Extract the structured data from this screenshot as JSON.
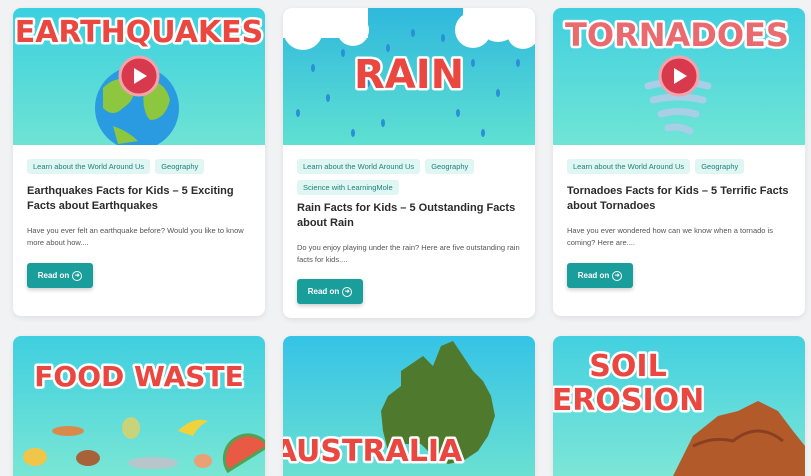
{
  "cards": [
    {
      "thumb_word": "EARTHQUAKES",
      "tags": [
        "Learn about the World Around Us",
        "Geography"
      ],
      "title": "Earthquakes Facts for Kids – 5 Exciting Facts about Earthquakes",
      "desc": "Have you ever felt an earthquake before? Would you like to know more about how....",
      "button": "Read on"
    },
    {
      "thumb_word": "RAIN",
      "tags": [
        "Learn about the World Around Us",
        "Geography",
        "Science with LearningMole"
      ],
      "title": "Rain Facts for Kids – 5 Outstanding Facts about Rain",
      "desc": "Do you enjoy playing under the rain? Here are five outstanding rain facts for kids....",
      "button": "Read on"
    },
    {
      "thumb_word": "TORNADOES",
      "tags": [
        "Learn about the World Around Us",
        "Geography"
      ],
      "title": "Tornadoes Facts for Kids – 5 Terrific Facts about Tornadoes",
      "desc": "Have you ever wondered how can we know when a tornado is coming? Here are....",
      "button": "Read on"
    }
  ],
  "bottom_cards": [
    {
      "thumb_word": "FOOD WASTE"
    },
    {
      "thumb_word": "AUSTRALIA"
    },
    {
      "thumb_word_1": "SOIL",
      "thumb_word_2": "EROSION"
    }
  ],
  "colors": {
    "accent": "#1a9e9b",
    "tag_bg": "#dff6f3",
    "word_red": "#e9473f"
  },
  "icons": [
    "play-icon",
    "arrow-right-circle-icon"
  ]
}
